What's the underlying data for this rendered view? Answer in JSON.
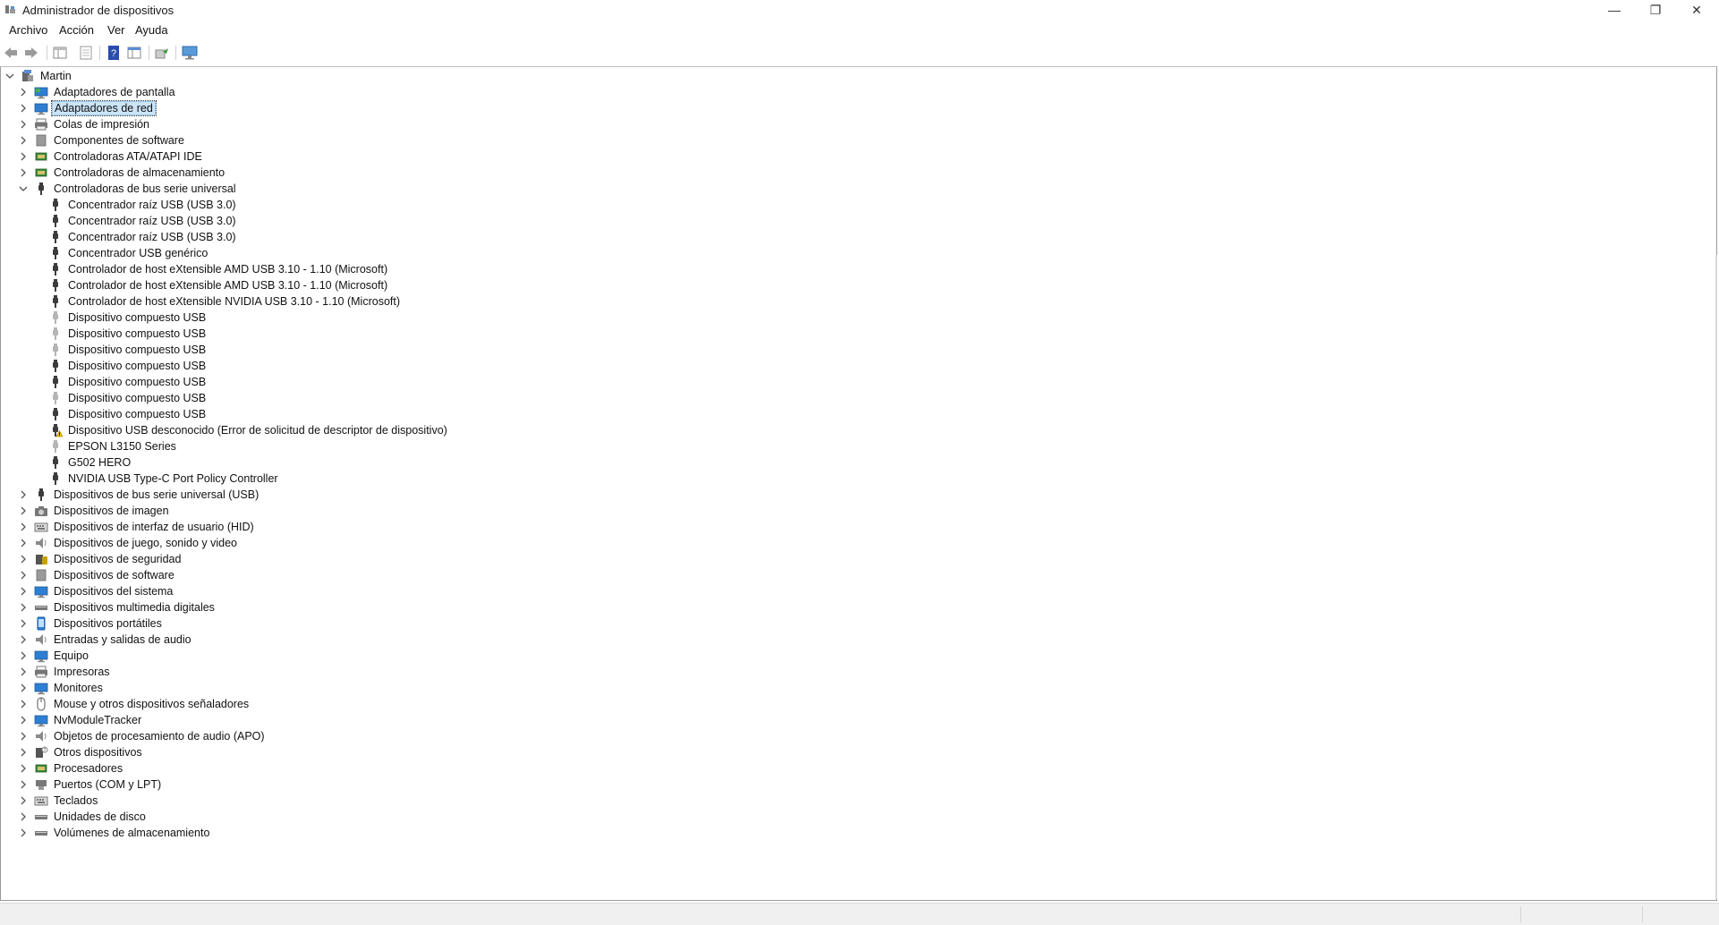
{
  "window": {
    "title": "Administrador de dispositivos"
  },
  "menu": [
    "Archivo",
    "Acción",
    "Ver",
    "Ayuda"
  ],
  "toolbar": [
    "back-icon",
    "forward-icon",
    "show-hide-tree-icon",
    "properties-icon",
    "help-icon",
    "view-icon",
    "update-driver-icon",
    "scan-hardware-icon"
  ],
  "tree": {
    "root": "Martin",
    "categories": [
      {
        "label": "Adaptadores de pantalla",
        "icon": "display-adapter-icon",
        "color": "#2d7fd3"
      },
      {
        "label": "Adaptadores de red",
        "icon": "network-adapter-icon",
        "color": "#2d7fd3",
        "selected": true
      },
      {
        "label": "Colas de impresión",
        "icon": "print-queue-icon",
        "color": "#555555"
      },
      {
        "label": "Componentes de software",
        "icon": "software-component-icon",
        "color": "#444444"
      },
      {
        "label": "Controladoras ATA/ATAPI IDE",
        "icon": "ide-controller-icon",
        "color": "#3a8a3a"
      },
      {
        "label": "Controladoras de almacenamiento",
        "icon": "storage-controller-icon",
        "color": "#3a8a3a"
      },
      {
        "label": "Controladoras de bus serie universal",
        "icon": "usb-icon",
        "color": "#444444",
        "expanded": true,
        "children": [
          {
            "label": "Concentrador raíz USB (USB 3.0)",
            "icon": "usb-icon"
          },
          {
            "label": "Concentrador raíz USB (USB 3.0)",
            "icon": "usb-icon"
          },
          {
            "label": "Concentrador raíz USB (USB 3.0)",
            "icon": "usb-icon"
          },
          {
            "label": "Concentrador USB genérico",
            "icon": "usb-icon"
          },
          {
            "label": "Controlador de host eXtensible AMD USB 3.10 - 1.10 (Microsoft)",
            "icon": "usb-icon"
          },
          {
            "label": "Controlador de host eXtensible AMD USB 3.10 - 1.10 (Microsoft)",
            "icon": "usb-icon"
          },
          {
            "label": "Controlador de host eXtensible NVIDIA USB 3.10 - 1.10 (Microsoft)",
            "icon": "usb-icon"
          },
          {
            "label": "Dispositivo compuesto USB",
            "icon": "usb-icon",
            "faded": true
          },
          {
            "label": "Dispositivo compuesto USB",
            "icon": "usb-icon",
            "faded": true
          },
          {
            "label": "Dispositivo compuesto USB",
            "icon": "usb-icon",
            "faded": true
          },
          {
            "label": "Dispositivo compuesto USB",
            "icon": "usb-icon"
          },
          {
            "label": "Dispositivo compuesto USB",
            "icon": "usb-icon"
          },
          {
            "label": "Dispositivo compuesto USB",
            "icon": "usb-icon",
            "faded": true
          },
          {
            "label": "Dispositivo compuesto USB",
            "icon": "usb-icon"
          },
          {
            "label": "Dispositivo USB desconocido (Error de solicitud de descriptor de dispositivo)",
            "icon": "usb-warning-icon"
          },
          {
            "label": "EPSON L3150 Series",
            "icon": "usb-icon",
            "faded": true
          },
          {
            "label": "G502 HERO",
            "icon": "usb-icon"
          },
          {
            "label": "NVIDIA USB Type-C Port Policy Controller",
            "icon": "usb-icon"
          }
        ]
      },
      {
        "label": "Dispositivos de bus serie universal (USB)",
        "icon": "usb-icon",
        "color": "#444444"
      },
      {
        "label": "Dispositivos de imagen",
        "icon": "camera-icon",
        "color": "#555555"
      },
      {
        "label": "Dispositivos de interfaz de usuario (HID)",
        "icon": "hid-icon",
        "color": "#666666"
      },
      {
        "label": "Dispositivos de juego, sonido y video",
        "icon": "speaker-icon",
        "color": "#777777"
      },
      {
        "label": "Dispositivos de seguridad",
        "icon": "security-device-icon",
        "color": "#c8a000"
      },
      {
        "label": "Dispositivos de software",
        "icon": "software-device-icon",
        "color": "#888888"
      },
      {
        "label": "Dispositivos del sistema",
        "icon": "system-device-icon",
        "color": "#2d7fd3"
      },
      {
        "label": "Dispositivos multimedia digitales",
        "icon": "media-device-icon",
        "color": "#555555"
      },
      {
        "label": "Dispositivos portátiles",
        "icon": "portable-device-icon",
        "color": "#2d7fd3"
      },
      {
        "label": "Entradas y salidas de audio",
        "icon": "audio-io-icon",
        "color": "#777777"
      },
      {
        "label": "Equipo",
        "icon": "computer-icon",
        "color": "#2d7fd3"
      },
      {
        "label": "Impresoras",
        "icon": "printer-icon",
        "color": "#555555"
      },
      {
        "label": "Monitores",
        "icon": "monitor-icon",
        "color": "#2d7fd3"
      },
      {
        "label": "Mouse y otros dispositivos señaladores",
        "icon": "mouse-icon",
        "color": "#666666"
      },
      {
        "label": "NvModuleTracker",
        "icon": "module-tracker-icon",
        "color": "#2d7fd3"
      },
      {
        "label": "Objetos de procesamiento de audio (APO)",
        "icon": "audio-processing-icon",
        "color": "#777777"
      },
      {
        "label": "Otros dispositivos",
        "icon": "other-devices-icon",
        "color": "#555555"
      },
      {
        "label": "Procesadores",
        "icon": "processor-icon",
        "color": "#3a8a3a"
      },
      {
        "label": "Puertos (COM y LPT)",
        "icon": "port-icon",
        "color": "#555555"
      },
      {
        "label": "Teclados",
        "icon": "keyboard-icon",
        "color": "#777777"
      },
      {
        "label": "Unidades de disco",
        "icon": "disk-drive-icon",
        "color": "#555555"
      },
      {
        "label": "Volúmenes de almacenamiento",
        "icon": "storage-volume-icon",
        "color": "#555555"
      }
    ]
  }
}
